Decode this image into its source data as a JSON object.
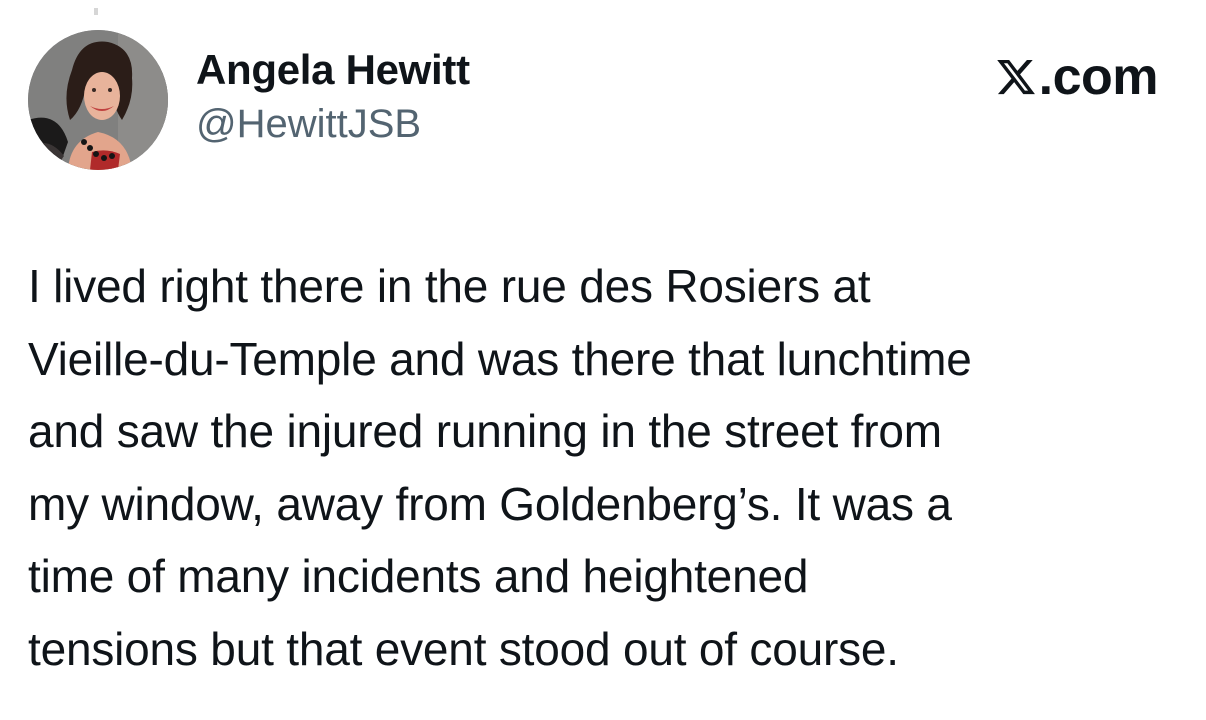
{
  "tweet": {
    "author": {
      "display_name": "Angela Hewitt",
      "handle": "@HewittJSB",
      "avatar_icon": "profile-photo"
    },
    "brand": {
      "logo_icon": "x-logo-icon",
      "suffix": ".com"
    },
    "lines": [
      "I lived right there in the rue des Rosiers at",
      "Vieille-du-Temple and was there that lunchtime",
      "and saw the injured running in the street from",
      "my window, away from Goldenberg’s. It was a",
      "time of many incidents and heightened",
      "tensions but that event stood out of course."
    ]
  },
  "colors": {
    "text_primary": "#0f1419",
    "text_secondary": "#536471",
    "background": "#ffffff"
  }
}
